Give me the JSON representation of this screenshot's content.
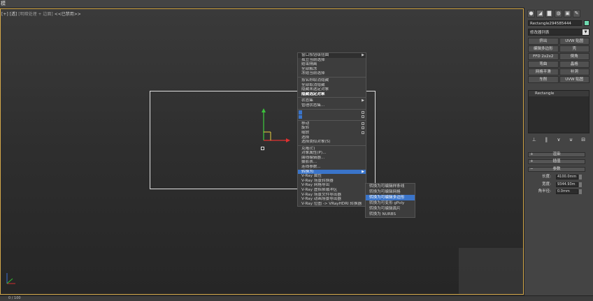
{
  "menubar": {
    "title": "模"
  },
  "viewport": {
    "label_prefix": "[+] [",
    "label_view": "透",
    "label_suffix": "]",
    "label_shading": "[明暗处理 + 边面]",
    "label_disabled": "<<已禁用>>"
  },
  "context_menu": {
    "items": [
      {
        "label": "窗口按钮级扭曲",
        "type": "header",
        "arrow": true
      },
      {
        "label": "孤立当前选择"
      },
      {
        "label": "结束隔离"
      },
      {
        "label": "全部解冻"
      },
      {
        "label": "冻结当前选择"
      },
      {
        "label": "按名称取消隐藏"
      },
      {
        "label": "全部取消隐藏"
      },
      {
        "label": "隐藏未选定对象"
      },
      {
        "label": "隐藏选定对象",
        "bold": true
      },
      {
        "label": "状态集",
        "arrow": true
      },
      {
        "label": "管理状态集..."
      },
      {
        "label": "",
        "blue": true,
        "box": true
      },
      {
        "label": "",
        "blue": true,
        "box": true
      },
      {
        "label": "移动",
        "box": true
      },
      {
        "label": "旋转",
        "box": true
      },
      {
        "label": "缩放",
        "box": true
      },
      {
        "label": "选择"
      },
      {
        "label": "选择类似对象(S)"
      },
      {
        "label": "克隆(C)"
      },
      {
        "label": "对象属性(P)..."
      },
      {
        "label": "曲线编辑器..."
      },
      {
        "label": "摄影表..."
      },
      {
        "label": "连线参数..."
      },
      {
        "label": "转换为:",
        "highlight": true,
        "arrow": true
      },
      {
        "label": "V-Ray 属性"
      },
      {
        "label": "V-Ray 场景转换器"
      },
      {
        "label": "V-Ray 网格导出"
      },
      {
        "label": "V-Ray 虚拟帧缓冲区"
      },
      {
        "label": "V-Ray 场景文件导出器"
      },
      {
        "label": "V-Ray 动画场景导出器"
      },
      {
        "label": "V-Ray 位图 -> VRayHDRI 转换器"
      }
    ]
  },
  "submenu": {
    "items": [
      {
        "label": "转换为可编辑样条线"
      },
      {
        "label": "转换为可编辑网格"
      },
      {
        "label": "转换为可编辑多边形",
        "highlight": true
      },
      {
        "label": "转换为可变形 gPoly"
      },
      {
        "label": "转换为可编辑面片"
      },
      {
        "label": "转换为 NURBS"
      }
    ]
  },
  "panel": {
    "tabs": [
      "●",
      "◢",
      "▇",
      "◍",
      "▣",
      "✎"
    ],
    "object_name": "Rectangle294585444",
    "object_color": "#6fd9b0",
    "modifier_list": "修改器列表",
    "buttons": [
      "挤出",
      "UVW 贴图",
      "编辑多边形",
      "壳",
      "FFD 2x2x2",
      "倒角",
      "弯曲",
      "晶格",
      "网格平滑",
      "补洞",
      "车削",
      "UVW 贴图"
    ],
    "stack_item": "Rectangle",
    "stack_icons": [
      "⊥",
      "‖",
      "∨",
      "⊍",
      "⊟"
    ],
    "rollouts": {
      "render": "渲染",
      "interp": "插值",
      "params": "参数"
    },
    "params": [
      {
        "label": "长度:",
        "value": "4100.0mm"
      },
      {
        "label": "宽度:",
        "value": "9344.93m"
      },
      {
        "label": "角半径:",
        "value": "0.0mm"
      }
    ]
  },
  "status": {
    "frame": "0 / 100"
  }
}
